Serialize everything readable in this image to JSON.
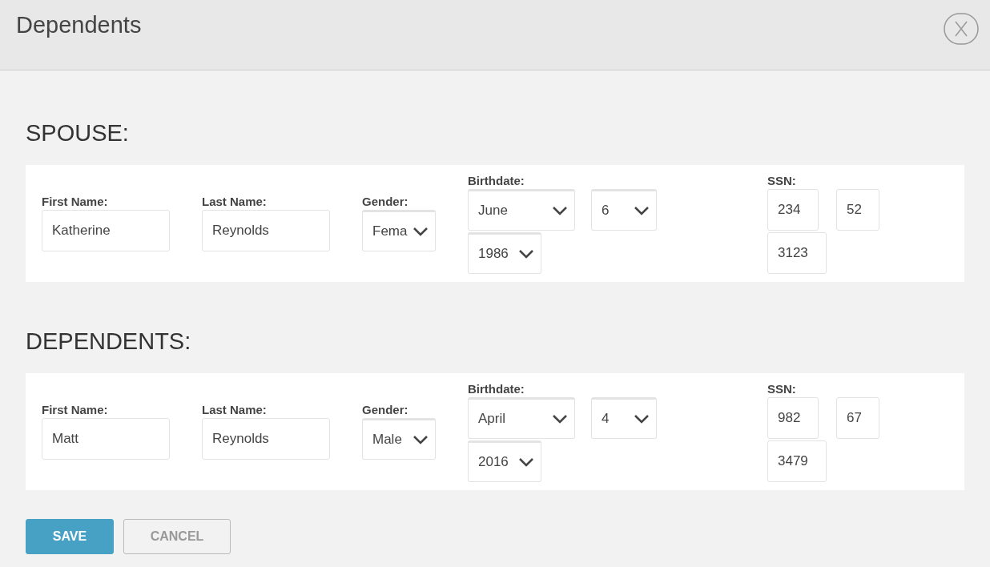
{
  "title": "Dependents",
  "sections": [
    {
      "heading": "SPOUSE:",
      "first_name": {
        "label": "First Name:",
        "value": "Katherine"
      },
      "last_name": {
        "label": "Last Name:",
        "value": "Reynolds"
      },
      "gender": {
        "label": "Gender:",
        "value": "Fema"
      },
      "birthdate": {
        "label": "Birthdate:",
        "month": "June",
        "day": "6",
        "year": "1986"
      },
      "ssn": {
        "label": "SSN:",
        "parts": [
          "234",
          "52",
          "3123"
        ]
      }
    },
    {
      "heading": "DEPENDENTS:",
      "first_name": {
        "label": "First Name:",
        "value": "Matt"
      },
      "last_name": {
        "label": "Last Name:",
        "value": "Reynolds"
      },
      "gender": {
        "label": "Gender:",
        "value": "Male"
      },
      "birthdate": {
        "label": "Birthdate:",
        "month": "April",
        "day": "4",
        "year": "2016"
      },
      "ssn": {
        "label": "SSN:",
        "parts": [
          "982",
          "67",
          "3479"
        ]
      }
    }
  ],
  "buttons": [
    {
      "label": "SAVE",
      "kind": "primary"
    },
    {
      "label": "CANCEL",
      "kind": "secondary"
    }
  ]
}
